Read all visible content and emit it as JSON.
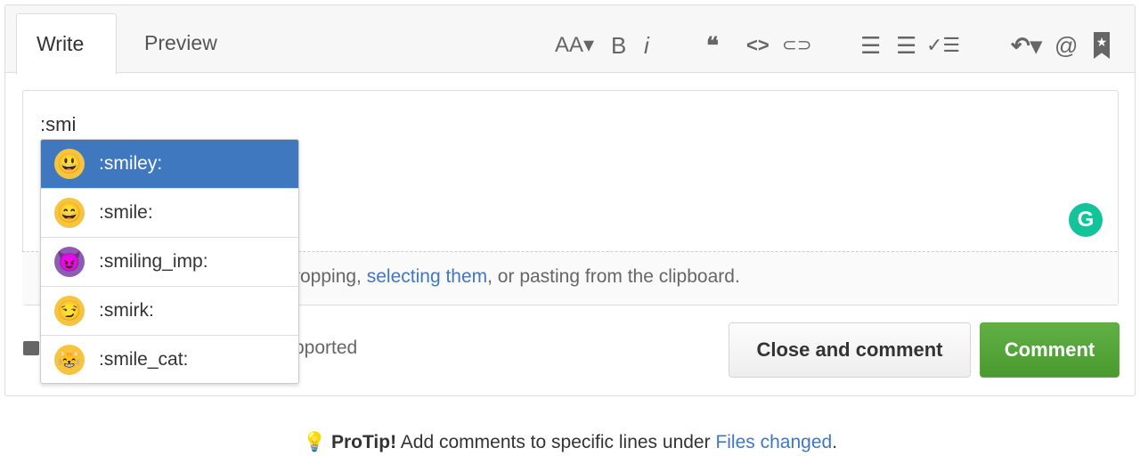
{
  "tabs": [
    {
      "label": "Write"
    },
    {
      "label": "Preview"
    }
  ],
  "toolbar": {
    "heading": "AA▾",
    "bold": "B",
    "italic": "i",
    "quote": "❝",
    "code": "<>",
    "link": "⊂⊃",
    "ul": "☰",
    "ol": "☰",
    "task": "✓☰",
    "reply": "↶▾",
    "mention": "@",
    "saved": "★"
  },
  "editor": {
    "value": ":smi",
    "drop_text_visible": "ropping,",
    "drop_link": "selecting them",
    "drop_text_end": ", or pasting from the clipboard.",
    "markdown_visible": "pported"
  },
  "autocomplete": [
    {
      "label": ":smiley:",
      "emoji": "😃",
      "selected": true
    },
    {
      "label": ":smile:",
      "emoji": "😄"
    },
    {
      "label": ":smiling_imp:",
      "emoji": "😈"
    },
    {
      "label": ":smirk:",
      "emoji": "😏"
    },
    {
      "label": ":smile_cat:",
      "emoji": "😸"
    }
  ],
  "buttons": {
    "close": "Close and comment",
    "comment": "Comment"
  },
  "grammarly": "G",
  "protip": {
    "bold": "ProTip!",
    "text": " Add comments to specific lines under ",
    "link": "Files changed",
    "end": "."
  },
  "colors": {
    "accent": "#4078c0",
    "comment_green": "#55a532",
    "grammarly": "#15c39a"
  }
}
